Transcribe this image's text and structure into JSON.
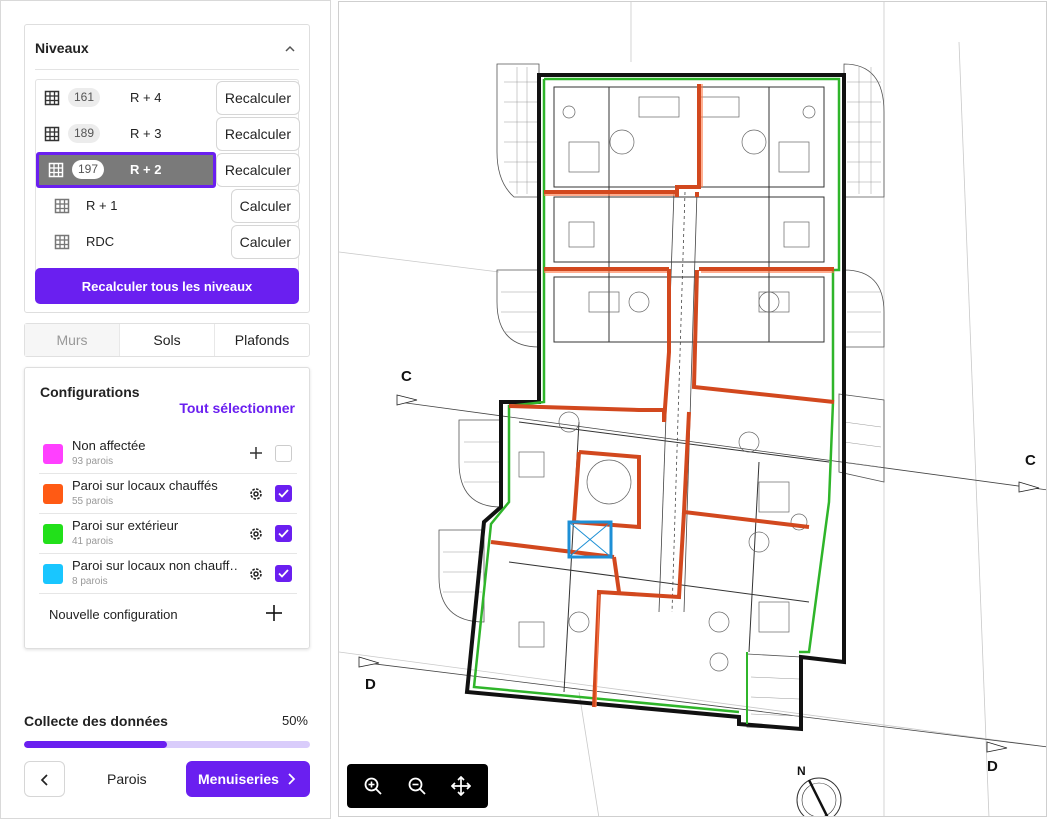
{
  "sidebar": {
    "levels": {
      "title": "Niveaux",
      "items": [
        {
          "count": "161",
          "name": "R + 4",
          "action": "Recalculer"
        },
        {
          "count": "189",
          "name": "R + 3",
          "action": "Recalculer"
        },
        {
          "count": "197",
          "name": "R + 2",
          "action": "Recalculer"
        },
        {
          "count": "",
          "name": "R + 1",
          "action": "Calculer"
        },
        {
          "count": "",
          "name": "RDC",
          "action": "Calculer"
        }
      ],
      "recalc_all": "Recalculer tous les niveaux"
    },
    "tabs": [
      "Murs",
      "Sols",
      "Plafonds"
    ],
    "configurations": {
      "title": "Configurations",
      "select_all": "Tout sélectionner",
      "items": [
        {
          "name": "Non affectée",
          "count": "93 parois",
          "color": "#ff40ff"
        },
        {
          "name": "Paroi sur locaux chauffés",
          "count": "55 parois",
          "color": "#ff5a14"
        },
        {
          "name": "Paroi sur extérieur",
          "count": "41 parois",
          "color": "#22e01a"
        },
        {
          "name": "Paroi sur locaux non chauff…",
          "count": "8 parois",
          "color": "#19c6ff"
        }
      ],
      "new_label": "Nouvelle configuration"
    },
    "progress": {
      "label": "Collecte des données",
      "percent_text": "50%",
      "value": 0.5
    },
    "footer": {
      "step_label": "Parois",
      "next_label": "Menuiseries"
    }
  },
  "plan": {
    "axis_labels": {
      "c_left": "C",
      "c_right": "C",
      "d_left": "D",
      "d_right": "D"
    },
    "north": "N"
  },
  "colors": {
    "accent": "#6a1ff0",
    "wall_heated": "#d2481e",
    "wall_exterior": "#2fb52a",
    "wall_unheated": "#1d8fd6"
  }
}
